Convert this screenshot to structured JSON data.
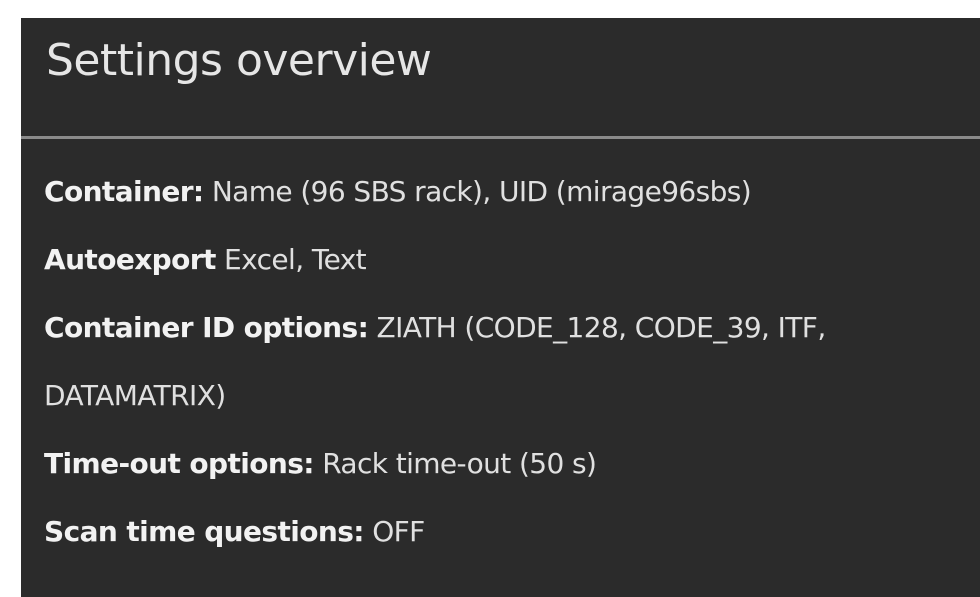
{
  "header": {
    "title": "Settings overview"
  },
  "settings": [
    {
      "label": "Container:",
      "value": " Name (96 SBS rack), UID (mirage96sbs)"
    },
    {
      "label": "Autoexport",
      "value": " Excel, Text"
    },
    {
      "label": "Container ID options:",
      "value": " ZIATH (CODE_128, CODE_39, ITF,",
      "value_line2": "DATAMATRIX)"
    },
    {
      "label": "Time-out options:",
      "value": " Rack time-out (50 s)"
    },
    {
      "label": "Scan time questions:",
      "value": " OFF"
    }
  ],
  "colors": {
    "panel_background": "#2b2b2b",
    "divider": "#8a8a8a",
    "text": "#ececec"
  }
}
